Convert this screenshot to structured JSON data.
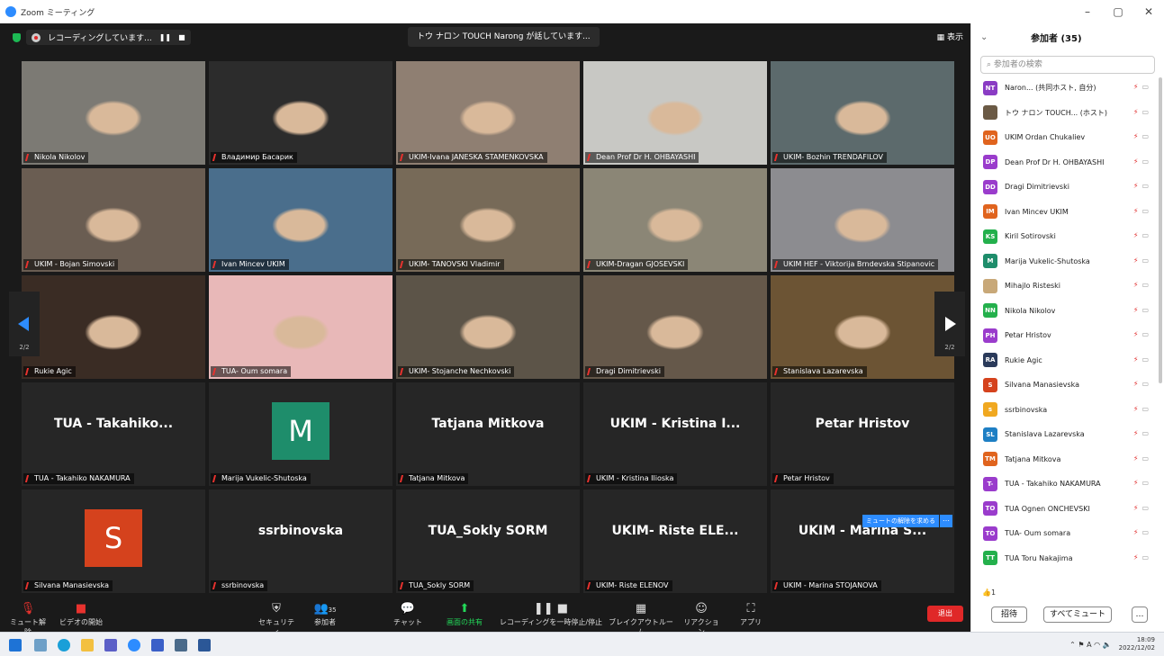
{
  "window": {
    "title": "Zoom ミーティング",
    "controls": [
      "–",
      "▢",
      "✕"
    ]
  },
  "topbar": {
    "recording_label": "レコーディングしています...",
    "speaking_label": "トウ ナロン TOUCH Narong が話しています...",
    "view_label": "表示"
  },
  "tiles": [
    {
      "name": "Nikola Nikolov",
      "kind": "video",
      "bg": "#7c7a74"
    },
    {
      "name": "Владимир Басарик",
      "kind": "video",
      "bg": "#2c2c2c"
    },
    {
      "name": "UKIM-Ivana JANESKA STAMENKOVSKA",
      "kind": "video",
      "bg": "#8f7f72"
    },
    {
      "name": "Dean Prof Dr H. OHBAYASHI",
      "kind": "video",
      "bg": "#c8c8c4"
    },
    {
      "name": "UKIM- Bozhin TRENDAFILOV",
      "kind": "video",
      "bg": "#5c6a6c"
    },
    {
      "name": "UKIM - Bojan Simovski",
      "kind": "video",
      "bg": "#6a5d52"
    },
    {
      "name": "Ivan Mincev UKIM",
      "kind": "video",
      "bg": "#4a6e8c"
    },
    {
      "name": "UKIM- TANOVSKI Vladimir",
      "kind": "video",
      "bg": "#776a58"
    },
    {
      "name": "UKIM-Dragan GJOSEVSKI",
      "kind": "video",
      "bg": "#8b8676"
    },
    {
      "name": "UKIM HEF - Viktorija Brndevska Stipanovic",
      "kind": "video",
      "bg": "#8c8c90"
    },
    {
      "name": "Rukie Agic",
      "kind": "video",
      "bg": "#3a2c24"
    },
    {
      "name": "TUA- Oum somara",
      "kind": "video",
      "bg": "#e8b8b8"
    },
    {
      "name": "UKIM- Stojanche Nechkovski",
      "kind": "video",
      "bg": "#5c5448"
    },
    {
      "name": "Dragi Dimitrievski",
      "kind": "video",
      "bg": "#65584a"
    },
    {
      "name": "Stanislava Lazarevska",
      "kind": "video",
      "bg": "#6c5434"
    },
    {
      "name": "TUA - Takahiko NAKAMURA",
      "kind": "text",
      "display": "TUA - Takahiko..."
    },
    {
      "name": "Marija Vukelic-Shutoska",
      "kind": "avatar",
      "letter": "M",
      "color": "#1e8d6b"
    },
    {
      "name": "Tatjana Mitkova",
      "kind": "text",
      "display": "Tatjana Mitkova"
    },
    {
      "name": "UKIM - Kristina Ilioska",
      "kind": "text",
      "display": "UKIM - Kristina I..."
    },
    {
      "name": "Petar Hristov",
      "kind": "text",
      "display": "Petar Hristov"
    },
    {
      "name": "Silvana Manasievska",
      "kind": "avatar",
      "letter": "S",
      "color": "#d5421d"
    },
    {
      "name": "ssrbinovska",
      "kind": "text",
      "display": "ssrbinovska"
    },
    {
      "name": "TUA_Sokly SORM",
      "kind": "text",
      "display": "TUA_Sokly SORM"
    },
    {
      "name": "UKIM- Riste ELENOV",
      "kind": "text",
      "display": "UKIM- Riste ELE..."
    },
    {
      "name": "UKIM - Marina STOJANOVA",
      "kind": "text",
      "display": "UKIM - Marina S..."
    }
  ],
  "nav": {
    "page": "2/2"
  },
  "unmute_request": "ミュートの解除を求める",
  "toolbar": {
    "unmute": "ミュート解除",
    "video": "ビデオの開始",
    "security": "セキュリティ",
    "participants": "参加者",
    "participant_count": "35",
    "chat": "チャット",
    "share": "画面の共有",
    "pause_rec": "レコーディングを一時停止/停止",
    "breakout": "ブレイクアウトルーム",
    "reactions": "リアクション",
    "apps": "アプリ",
    "leave": "退出"
  },
  "panel": {
    "title": "参加者 (35)",
    "search_placeholder": "参加者の検索",
    "participants": [
      {
        "initials": "NT",
        "color": "#8a3cc4",
        "name": "Naron... (共同ホスト, 自分)"
      },
      {
        "initials": "",
        "color": "#6b5a45",
        "name": "トウ ナロン TOUCH... (ホスト)"
      },
      {
        "initials": "UO",
        "color": "#e0641e",
        "name": "UKIM Ordan Chukaliev"
      },
      {
        "initials": "DP",
        "color": "#9a3ccc",
        "name": "Dean Prof Dr H. OHBAYASHI"
      },
      {
        "initials": "DD",
        "color": "#9a3ccc",
        "name": "Dragi Dimitrievski"
      },
      {
        "initials": "IM",
        "color": "#e0641e",
        "name": "Ivan Mincev UKIM"
      },
      {
        "initials": "KS",
        "color": "#24b04c",
        "name": "Kiril Sotirovski"
      },
      {
        "initials": "M",
        "color": "#1e8d6b",
        "name": "Marija Vukelic-Shutoska"
      },
      {
        "initials": "",
        "color": "#c8a878",
        "name": "Mihajlo Risteski"
      },
      {
        "initials": "NN",
        "color": "#24b04c",
        "name": "Nikola Nikolov"
      },
      {
        "initials": "PH",
        "color": "#9a3ccc",
        "name": "Petar Hristov"
      },
      {
        "initials": "RA",
        "color": "#2a3a5a",
        "name": "Rukie Agic"
      },
      {
        "initials": "S",
        "color": "#d5421d",
        "name": "Silvana Manasievska"
      },
      {
        "initials": "s",
        "color": "#f0a820",
        "name": "ssrbinovska"
      },
      {
        "initials": "SL",
        "color": "#1e7fc4",
        "name": "Stanislava Lazarevska"
      },
      {
        "initials": "TM",
        "color": "#e0641e",
        "name": "Tatjana Mitkova"
      },
      {
        "initials": "T-",
        "color": "#9a3ccc",
        "name": "TUA - Takahiko NAKAMURA"
      },
      {
        "initials": "TO",
        "color": "#9a3ccc",
        "name": "TUA Ognen ONCHEVSKI"
      },
      {
        "initials": "TO",
        "color": "#9a3ccc",
        "name": "TUA- Oum somara"
      },
      {
        "initials": "TT",
        "color": "#24b04c",
        "name": "TUA Toru Nakajima"
      }
    ],
    "reaction_count": "1",
    "invite": "招待",
    "mute_all": "すべてミュート",
    "more": "…"
  },
  "taskbar": {
    "time": "18:09",
    "date": "2022/12/02"
  }
}
